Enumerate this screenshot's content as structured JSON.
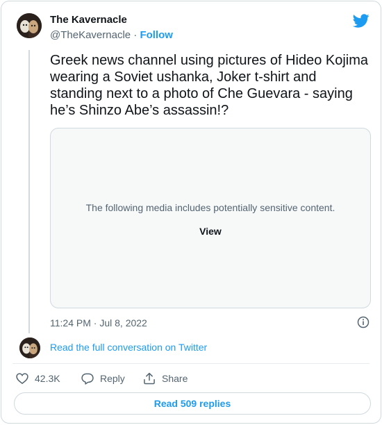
{
  "tweet": {
    "author_name": "The Kavernacle",
    "author_handle": "@TheKavernacle",
    "separator": "·",
    "follow_label": "Follow",
    "text": "Greek news channel using pictures of Hideo Kojima wearing a Soviet ushanka, Joker t-shirt and standing next to a photo of Che Guevara - saying he’s Shinzo Abe’s assassin!?",
    "media": {
      "warning_text": "The following media includes potentially sensitive content.",
      "view_label": "View"
    },
    "time": "11:24 PM",
    "date_separator": "·",
    "date": "Jul 8, 2022",
    "read_full_label": "Read the full conversation on Twitter",
    "actions": {
      "like_count": "42.3K",
      "reply_label": "Reply",
      "share_label": "Share"
    },
    "read_replies_label": "Read 509 replies"
  },
  "colors": {
    "accent": "#1d9bf0",
    "secondary_text": "#536471",
    "border": "#cfd9de",
    "media_bg": "#f7f9f9"
  },
  "icons": [
    "twitter-bird-icon",
    "info-icon",
    "heart-icon",
    "reply-icon",
    "share-icon"
  ]
}
